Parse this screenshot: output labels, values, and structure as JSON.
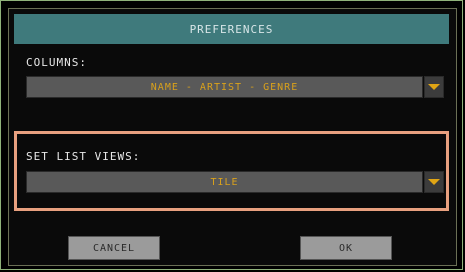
{
  "dialog": {
    "title": "PREFERENCES",
    "columns_label": "COLUMNS:",
    "columns_value": "NAME - ARTIST - GENRE",
    "setlist_label": "SET LIST VIEWS:",
    "setlist_value": "TILE",
    "cancel_label": "CANCEL",
    "ok_label": "OK"
  },
  "colors": {
    "title_bar": "#3f7a7c",
    "highlight_border": "#e8a07f",
    "dropdown_text": "#d9a11c",
    "dropdown_arrow": "#e0a514"
  },
  "icons": {
    "dropdown_arrow": "chevron-down-icon"
  }
}
